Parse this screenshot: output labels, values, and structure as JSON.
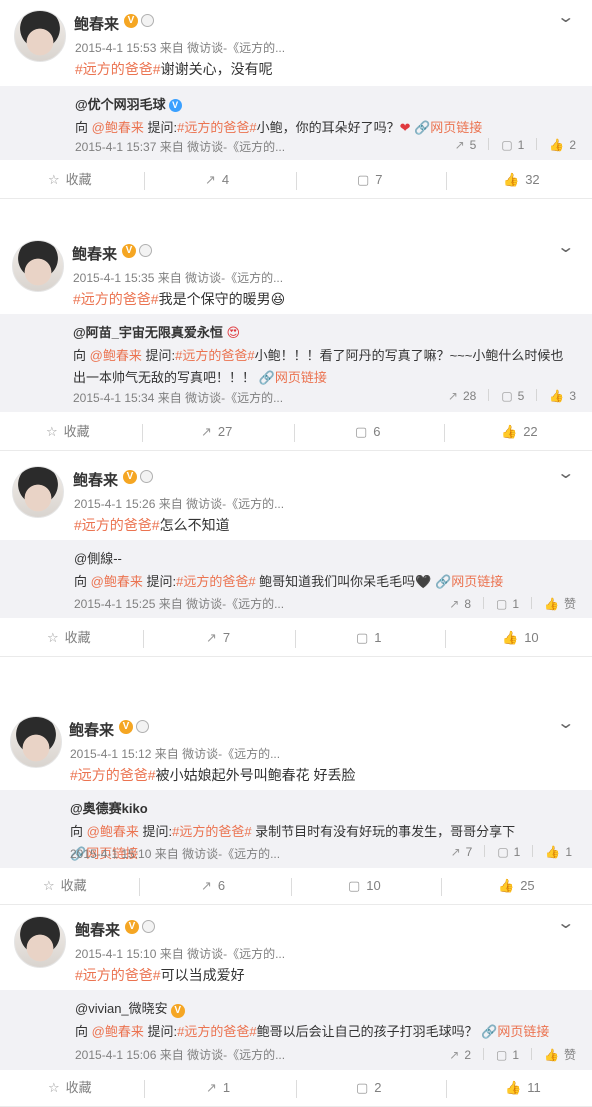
{
  "posts": [
    {
      "name": "鲍春来",
      "meta": "2015-4-1 15:53 来自 微访谈-《远方的...",
      "topic": "#远方的爸爸#",
      "text": "谢谢关心，没有呢",
      "quote": {
        "user": "@优个网羽毛球",
        "prefix": "向",
        "mention": "@鲍春来",
        "asked": "提问:",
        "qtopic": "#远方的爸爸#",
        "qtext": "小鲍，你的耳朵好了吗？",
        "emoji": "❤",
        "link": "网页链接",
        "meta": "2015-4-1 15:37 来自 微访谈-《远方的...",
        "repost": "5",
        "comment": "1",
        "like": "2"
      },
      "actions": {
        "fav": "收藏",
        "repost": "4",
        "comment": "7",
        "like": "32"
      }
    },
    {
      "name": "鲍春来",
      "meta": "2015-4-1 15:35 来自 微访谈-《远方的...",
      "topic": "#远方的爸爸#",
      "text": "我是个保守的暖男😆",
      "quote": {
        "user": "@阿苗_宇宙无限真爱永恒",
        "prefix": "向",
        "mention": "@鲍春来",
        "asked": "提问:",
        "qtopic": "#远方的爸爸#",
        "qtext": "小鲍！！！看了阿丹的写真了嘛？~~~小鲍什么时候也出一本帅气无敌的写真吧！！！",
        "emoji": "",
        "link": "网页链接",
        "meta": "2015-4-1 15:34 来自 微访谈-《远方的...",
        "repost": "28",
        "comment": "5",
        "like": "3"
      },
      "actions": {
        "fav": "收藏",
        "repost": "27",
        "comment": "6",
        "like": "22"
      }
    },
    {
      "name": "鲍春来",
      "meta": "2015-4-1 15:26 来自 微访谈-《远方的...",
      "topic": "#远方的爸爸#",
      "text": "怎么不知道",
      "quote": {
        "user": "@側線--",
        "prefix": "向",
        "mention": "@鲍春来",
        "asked": "提问:",
        "qtopic": "#远方的爸爸#",
        "qtext": " 鲍哥知道我们叫你呆毛毛吗🖤",
        "emoji": "",
        "link": "网页链接",
        "meta": "2015-4-1 15:25 来自 微访谈-《远方的...",
        "repost": "8",
        "comment": "1",
        "like": "赞"
      },
      "actions": {
        "fav": "收藏",
        "repost": "7",
        "comment": "1",
        "like": "10"
      }
    },
    {
      "name": "鲍春来",
      "meta": "2015-4-1 15:12 来自 微访谈-《远方的...",
      "topic": "#远方的爸爸#",
      "text": "被小姑娘起外号叫鲍春花 好丢脸",
      "quote": {
        "user": "@奥德赛kiko",
        "prefix": "向",
        "mention": "@鲍春来",
        "asked": "提问:",
        "qtopic": "#远方的爸爸#",
        "qtext": " 录制节目时有没有好玩的事发生，哥哥分享下",
        "emoji": "",
        "link": "网页链接",
        "meta": "2015-4-1 15:10 来自 微访谈-《远方的...",
        "repost": "7",
        "comment": "1",
        "like": "1"
      },
      "actions": {
        "fav": "收藏",
        "repost": "6",
        "comment": "10",
        "like": "25"
      }
    },
    {
      "name": "鲍春来",
      "meta": "2015-4-1 15:10 来自 微访谈-《远方的...",
      "topic": "#远方的爸爸#",
      "text": "可以当成爱好",
      "quote": {
        "user": "@vivian_微晓安",
        "prefix": "向",
        "mention": "@鲍春来",
        "asked": "提问:",
        "qtopic": "#远方的爸爸#",
        "qtext": "鲍哥以后会让自己的孩子打羽毛球吗？",
        "emoji": "",
        "link": "网页链接",
        "meta": "2015-4-1 15:06 来自 微访谈-《远方的...",
        "repost": "2",
        "comment": "1",
        "like": "赞"
      },
      "actions": {
        "fav": "收藏",
        "repost": "1",
        "comment": "2",
        "like": "11"
      }
    }
  ]
}
